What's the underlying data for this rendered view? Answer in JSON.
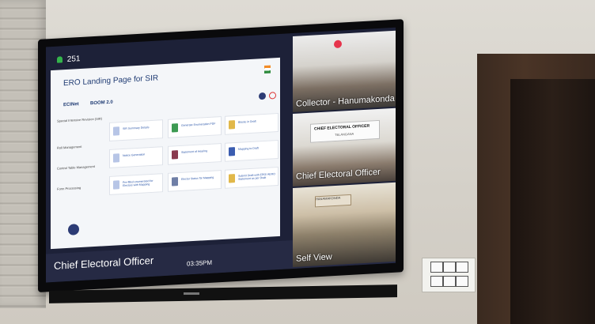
{
  "tv": {
    "participant_count": "251",
    "app_title": "ERO Landing Page for SIR",
    "brand_left": "ECINet",
    "brand_right": "BOOM 2.0",
    "sidebar": [
      "Special Intensive Revision (SIR)",
      "Roll Management",
      "Control Table Management",
      "Form Processing"
    ],
    "cards": [
      "SIR Summary Details",
      "Generate Enumeration PDF",
      "Blocks in Draft",
      "Notice Generation",
      "Statement of Hearing",
      "Mapping to Draft",
      "Pre-filled enumerated for Electors with Mapping",
      "Elector Status for Mapping",
      "Submit Draft with ERO/ AERO Statement as per Draft"
    ],
    "presenter_label": "Chief Electoral Officer",
    "time": "03:35PM",
    "tiles": [
      "Collector - Hanumakonda",
      "Chief Electoral Officer",
      "Self View"
    ],
    "sign_text": "CHIEF ELECTORAL OFFICER",
    "sign_sub": "TELANGANA",
    "banner_text": "HANAMAKONDA"
  }
}
